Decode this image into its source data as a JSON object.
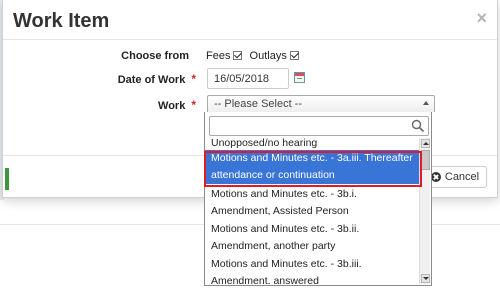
{
  "dialog": {
    "title": "Work Item",
    "close_glyph": "×"
  },
  "form": {
    "choose_from": {
      "label": "Choose from",
      "fees_label": "Fees",
      "fees_checked": true,
      "outlays_label": "Outlays",
      "outlays_checked": true
    },
    "date_of_work": {
      "label": "Date of Work",
      "required_mark": "*",
      "value": "16/05/2018"
    },
    "work": {
      "label": "Work",
      "required_mark": "*",
      "selected": "-- Please Select --",
      "search_value": "",
      "options": [
        "Unopposed/no hearing",
        "Motions and Minutes etc. - 3a.iii. Thereafter attendance or continuation",
        "Motions and Minutes etc. - 3b.i. Amendment, Assisted Person",
        "Motions and Minutes etc. - 3b.ii. Amendment, another party",
        "Motions and Minutes etc. - 3b.iii. Amendment, answered"
      ],
      "highlighted_index": 1
    }
  },
  "footer": {
    "cancel_label": "Cancel"
  },
  "colors": {
    "highlight": "#3875d7",
    "outline": "#e01b24",
    "required": "#d9262b"
  }
}
